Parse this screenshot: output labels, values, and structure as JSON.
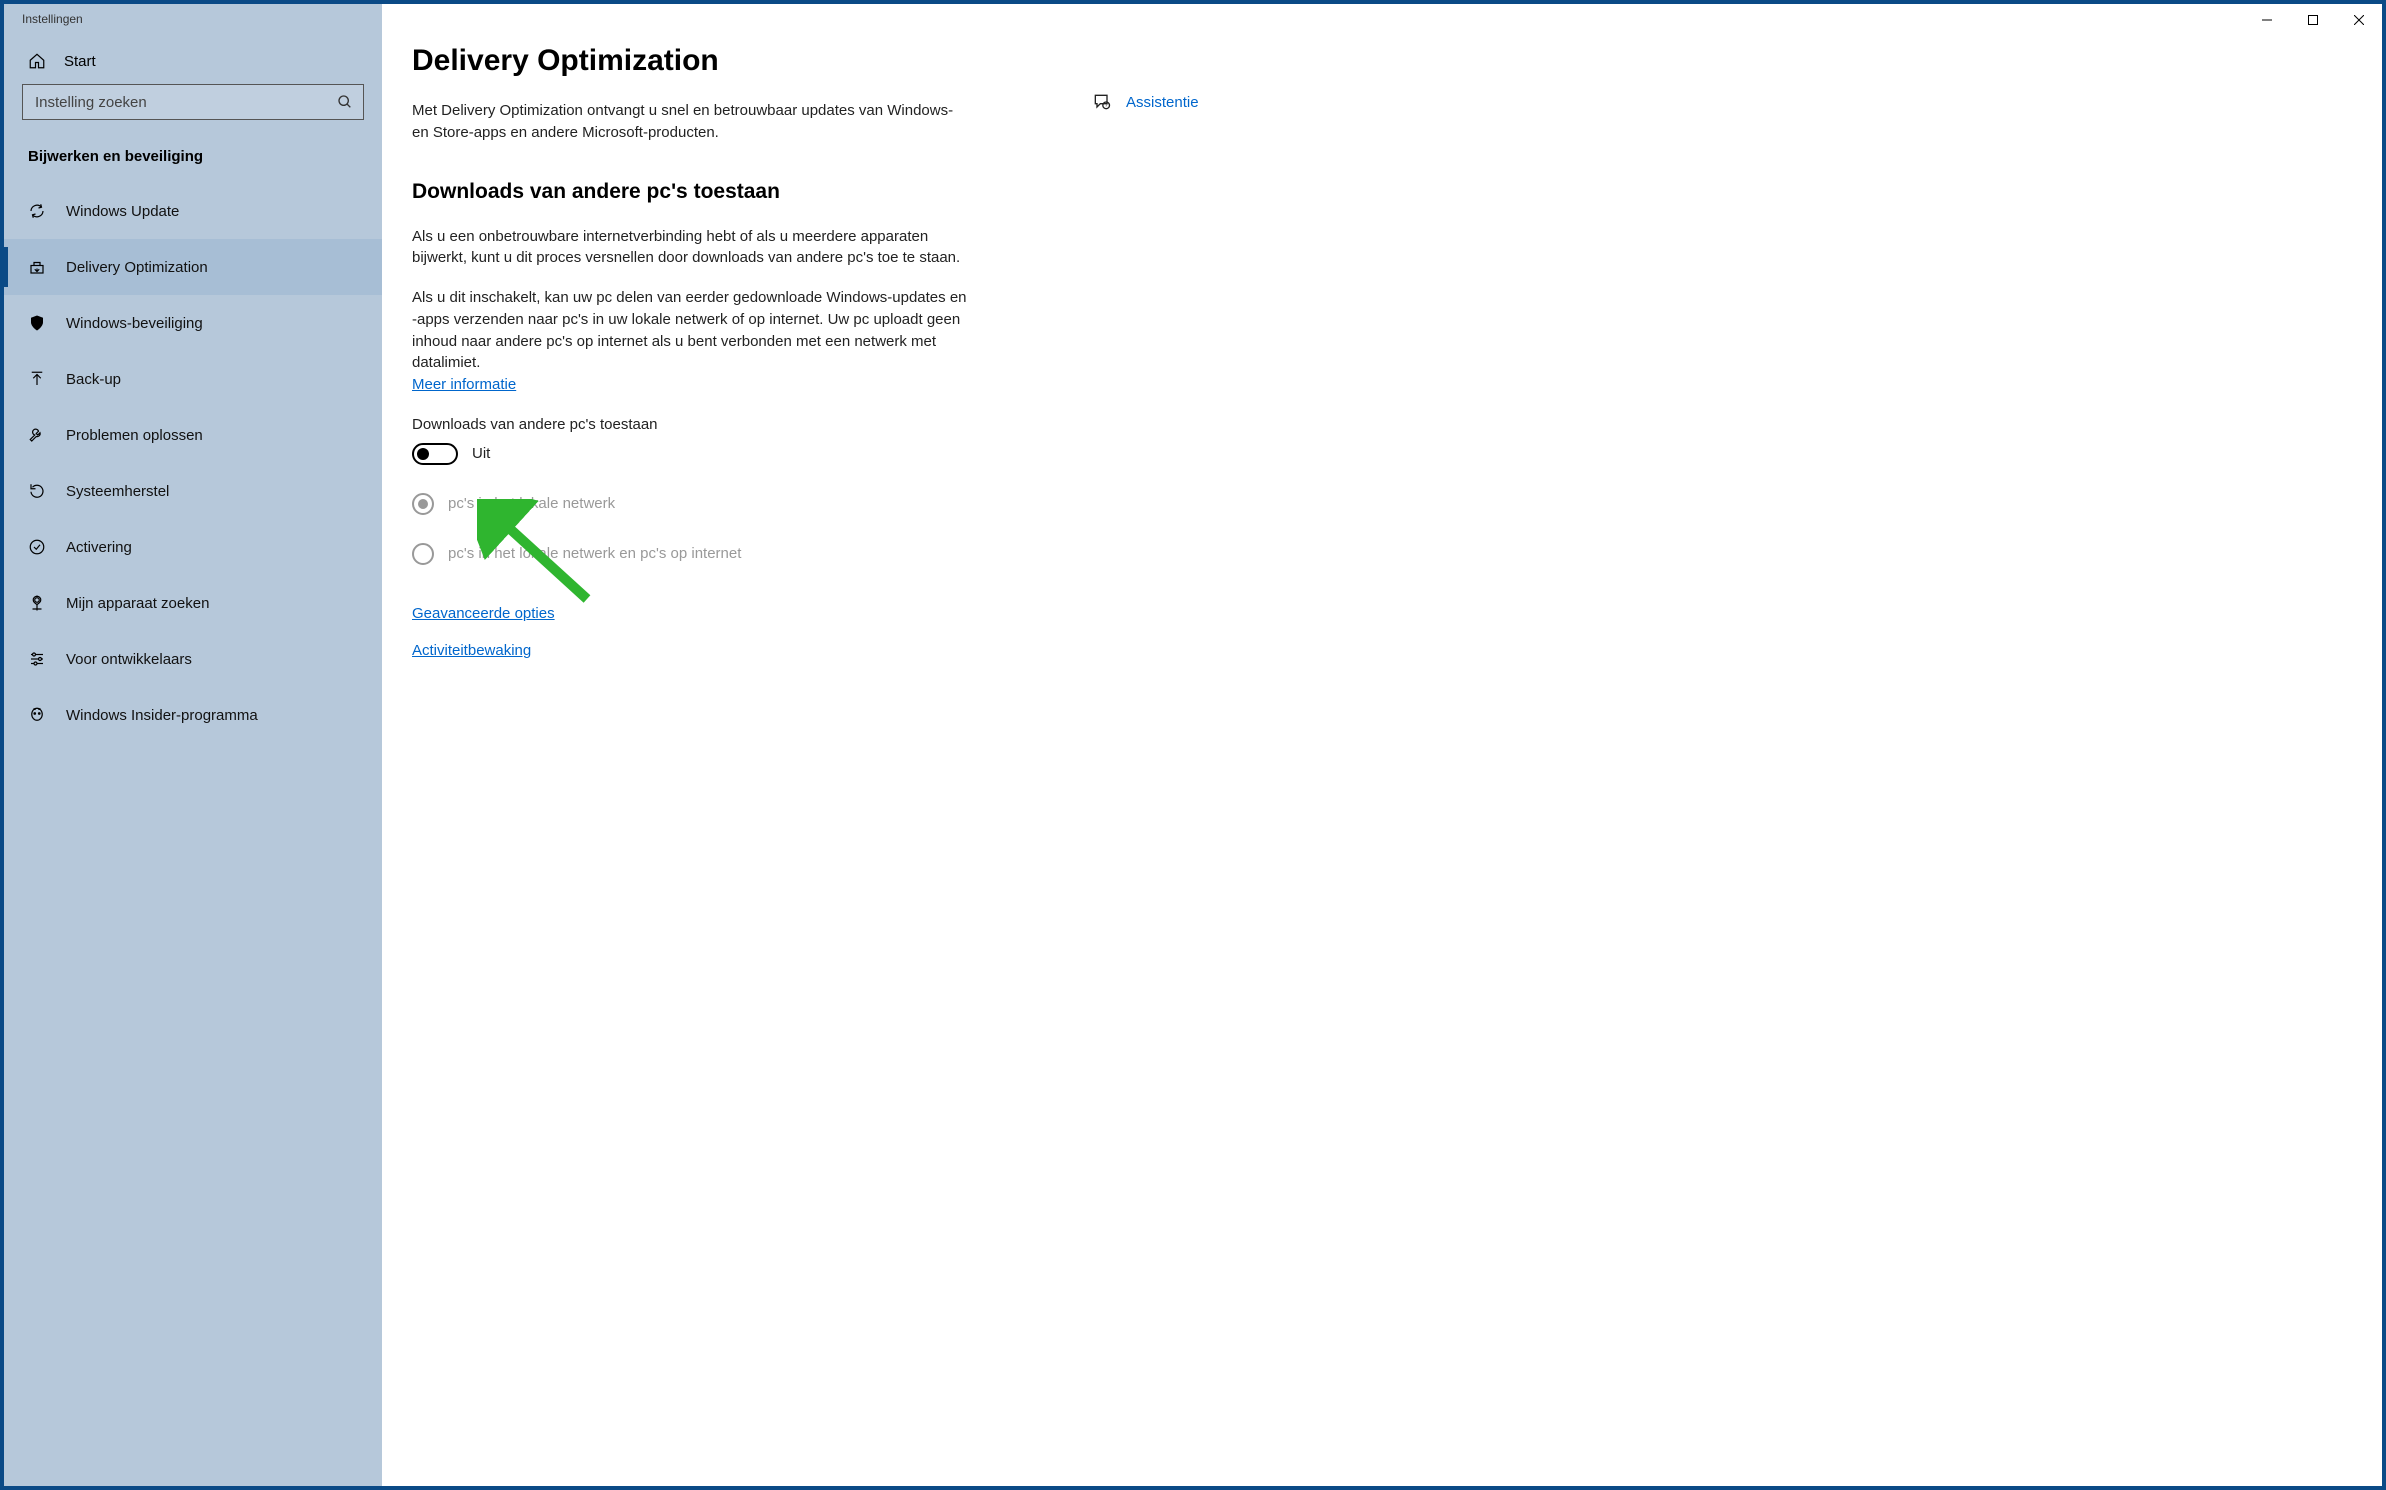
{
  "window": {
    "title": "Instellingen"
  },
  "sidebar": {
    "home": "Start",
    "search_placeholder": "Instelling zoeken",
    "category": "Bijwerken en beveiliging",
    "items": [
      {
        "label": "Windows Update"
      },
      {
        "label": "Delivery Optimization"
      },
      {
        "label": "Windows-beveiliging"
      },
      {
        "label": "Back-up"
      },
      {
        "label": "Problemen oplossen"
      },
      {
        "label": "Systeemherstel"
      },
      {
        "label": "Activering"
      },
      {
        "label": "Mijn apparaat zoeken"
      },
      {
        "label": "Voor ontwikkelaars"
      },
      {
        "label": "Windows Insider-programma"
      }
    ],
    "active_index": 1
  },
  "main": {
    "title": "Delivery Optimization",
    "intro": "Met Delivery Optimization ontvangt u snel en betrouwbaar updates van Windows- en Store-apps en andere Microsoft-producten.",
    "section_head": "Downloads van andere pc's toestaan",
    "para1": "Als u een onbetrouwbare internetverbinding hebt of als u meerdere apparaten bijwerkt, kunt u dit proces versnellen door downloads van andere pc's toe te staan.",
    "para2": "Als u dit inschakelt, kan uw pc delen van eerder gedownloade Windows-updates en -apps verzenden naar pc's in uw lokale netwerk of op internet. Uw pc uploadt geen inhoud naar andere pc's op internet als u bent verbonden met een netwerk met datalimiet.",
    "more_info": "Meer informatie",
    "toggle_label": "Downloads van andere pc's toestaan",
    "toggle_state": "Uit",
    "radio1": "pc's in het lokale netwerk",
    "radio2": "pc's in het lokale netwerk en pc's op internet",
    "advanced": "Geavanceerde opties",
    "activity": "Activiteitbewaking"
  },
  "right": {
    "assist": "Assistentie"
  }
}
